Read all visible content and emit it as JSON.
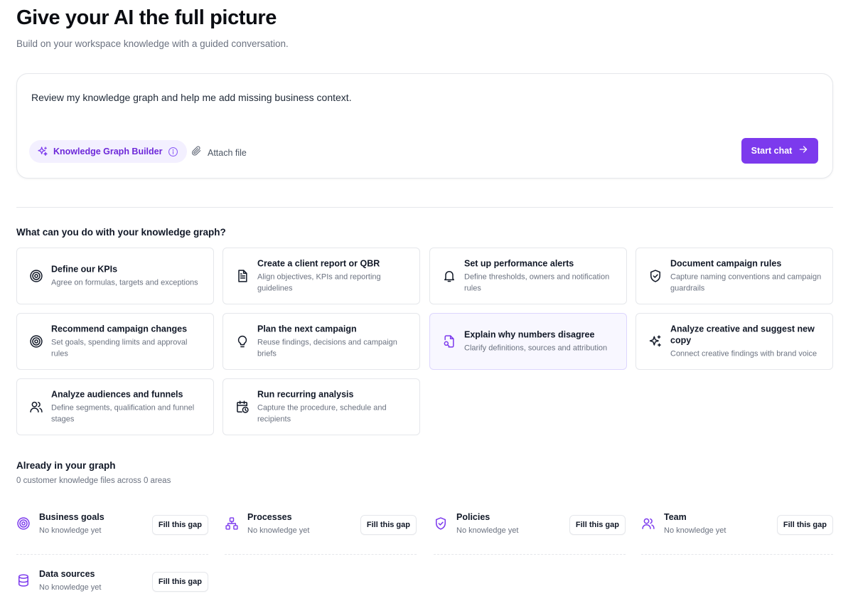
{
  "header": {
    "title": "Give your AI the full picture",
    "subtitle": "Build on your workspace knowledge with a guided conversation."
  },
  "composer": {
    "prompt_text": "Review my knowledge graph and help me add missing business context.",
    "mode_chip": {
      "label": "Knowledge Graph Builder",
      "icon": "sparkles-icon",
      "info_icon": "info-icon"
    },
    "attach": {
      "label": "Attach file",
      "icon": "paperclip-icon"
    },
    "start_button": {
      "label": "Start chat",
      "icon": "arrow-right-icon"
    }
  },
  "suggestions": {
    "title": "What can you do with your knowledge graph?",
    "cards": [
      {
        "title": "Define our KPIs",
        "description": "Agree on formulas, targets and exceptions",
        "icon": "target-icon"
      },
      {
        "title": "Create a client report or QBR",
        "description": "Align objectives, KPIs and reporting guidelines",
        "icon": "document-icon"
      },
      {
        "title": "Set up performance alerts",
        "description": "Define thresholds, owners and notification rules",
        "icon": "bell-icon"
      },
      {
        "title": "Document campaign rules",
        "description": "Capture naming conventions and campaign guardrails",
        "icon": "shield-check-icon"
      },
      {
        "title": "Recommend campaign changes",
        "description": "Set goals, spending limits and approval rules",
        "icon": "target-icon"
      },
      {
        "title": "Plan the next campaign",
        "description": "Reuse findings, decisions and campaign briefs",
        "icon": "lightbulb-icon"
      },
      {
        "title": "Explain why numbers disagree",
        "description": "Clarify definitions, sources and attribution",
        "icon": "file-search-icon",
        "highlighted": true
      },
      {
        "title": "Analyze creative and suggest new copy",
        "description": "Connect creative findings with brand voice",
        "icon": "sparkles-icon"
      },
      {
        "title": "Analyze audiences and funnels",
        "description": "Define segments, qualification and funnel stages",
        "icon": "users-icon"
      },
      {
        "title": "Run recurring analysis",
        "description": "Capture the procedure, schedule and recipients",
        "icon": "calendar-clock-icon"
      }
    ]
  },
  "graph": {
    "title": "Already in your graph",
    "summary": "0 customer knowledge files across 0 areas",
    "areas": [
      {
        "name": "Business goals",
        "status": "No knowledge yet",
        "button": "Fill this gap",
        "icon": "target-icon"
      },
      {
        "name": "Processes",
        "status": "No knowledge yet",
        "button": "Fill this gap",
        "icon": "workflow-icon"
      },
      {
        "name": "Policies",
        "status": "No knowledge yet",
        "button": "Fill this gap",
        "icon": "shield-check-icon"
      },
      {
        "name": "Team",
        "status": "No knowledge yet",
        "button": "Fill this gap",
        "icon": "users-icon"
      },
      {
        "name": "Data sources",
        "status": "No knowledge yet",
        "button": "Fill this gap",
        "icon": "database-icon"
      }
    ]
  },
  "colors": {
    "accent": "#7c3aed",
    "accent_text": "#6d28d9",
    "chip_bg": "#f3f0ff",
    "icon_dark": "#111827",
    "border": "#e5e7eb",
    "muted_text": "#6b7280"
  }
}
